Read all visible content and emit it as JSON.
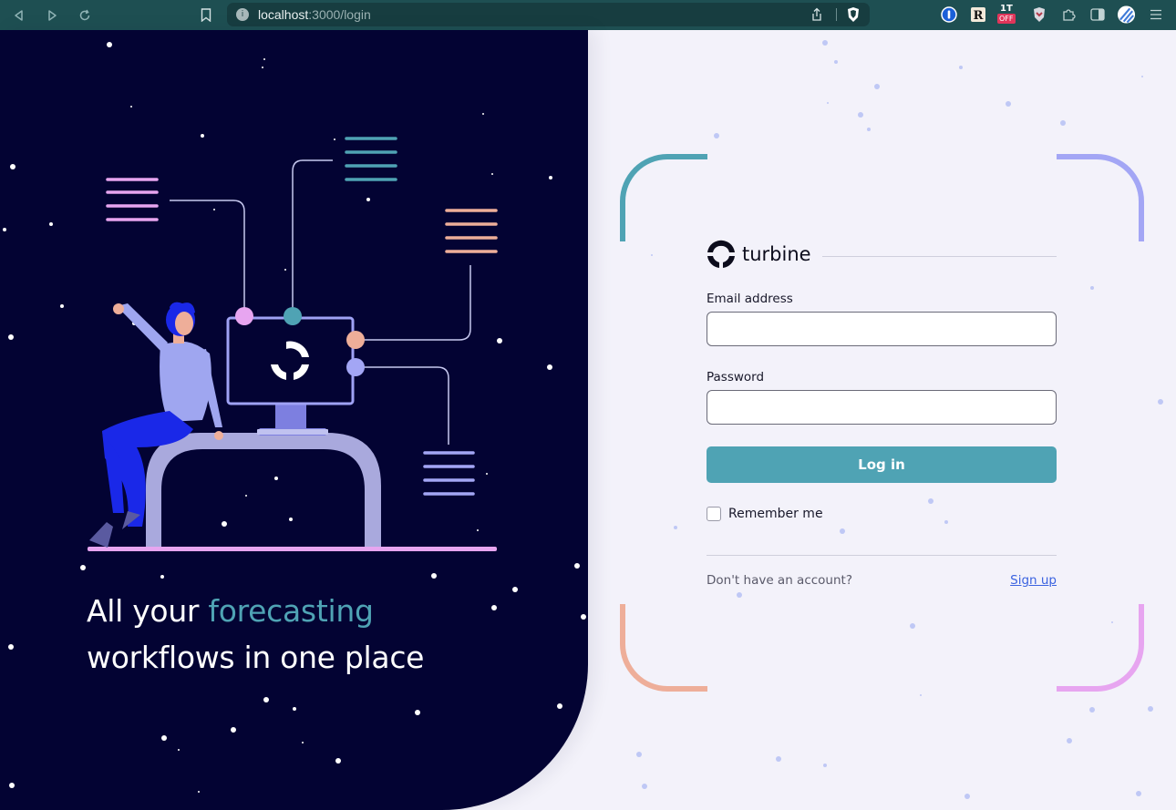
{
  "browser": {
    "url_host": "localhost",
    "url_path": ":3000/login",
    "extensions": [
      "1password-icon",
      "readwise-icon",
      "1t-off-icon",
      "shield-ext-icon",
      "puzzle-icon",
      "sidebar-icon",
      "profile-icon",
      "menu-icon"
    ],
    "ext_badge": "OFF",
    "ext_1t": "1T"
  },
  "left_panel": {
    "headline_part1": "All your ",
    "headline_accent": "forecasting",
    "headline_part2": "workflows in one place",
    "accent_color": "#4fa3b4",
    "background": "#030333"
  },
  "login": {
    "brand_name": "turbine",
    "email_label": "Email address",
    "email_value": "",
    "password_label": "Password",
    "password_value": "",
    "submit_label": "Log in",
    "remember_label": "Remember me",
    "remember_checked": false,
    "signup_prompt": "Don't have an account?",
    "signup_link": "Sign up",
    "button_color": "#4fa3b4",
    "link_color": "#3b63e0"
  }
}
